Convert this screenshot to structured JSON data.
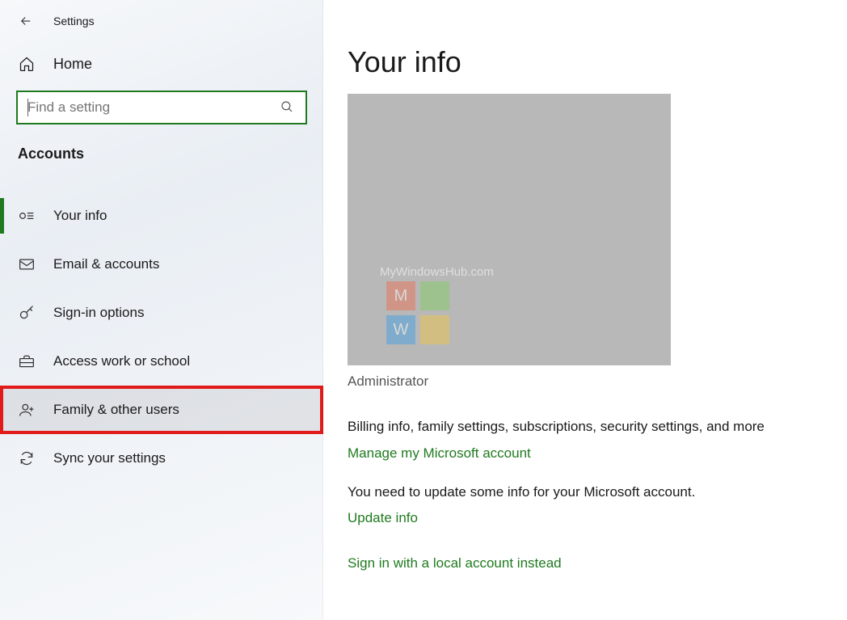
{
  "window": {
    "title": "Settings"
  },
  "sidebar": {
    "home_label": "Home",
    "search_placeholder": "Find a setting",
    "section_label": "Accounts",
    "items": [
      {
        "label": "Your info"
      },
      {
        "label": "Email & accounts"
      },
      {
        "label": "Sign-in options"
      },
      {
        "label": "Access work or school"
      },
      {
        "label": "Family & other users"
      },
      {
        "label": "Sync your settings"
      }
    ]
  },
  "main": {
    "heading": "Your info",
    "role": "Administrator",
    "watermark_text": "MyWindowsHub.com",
    "watermark_letters": {
      "tl": "M",
      "br": "W"
    },
    "billing_text": "Billing info, family settings, subscriptions, security settings, and more",
    "manage_link": "Manage my Microsoft account",
    "update_text": "You need to update some info for your Microsoft account.",
    "update_link": "Update info",
    "local_link": "Sign in with a local account instead"
  },
  "colors": {
    "accent": "#1f7a1f",
    "highlight_box": "#e11a1a"
  }
}
